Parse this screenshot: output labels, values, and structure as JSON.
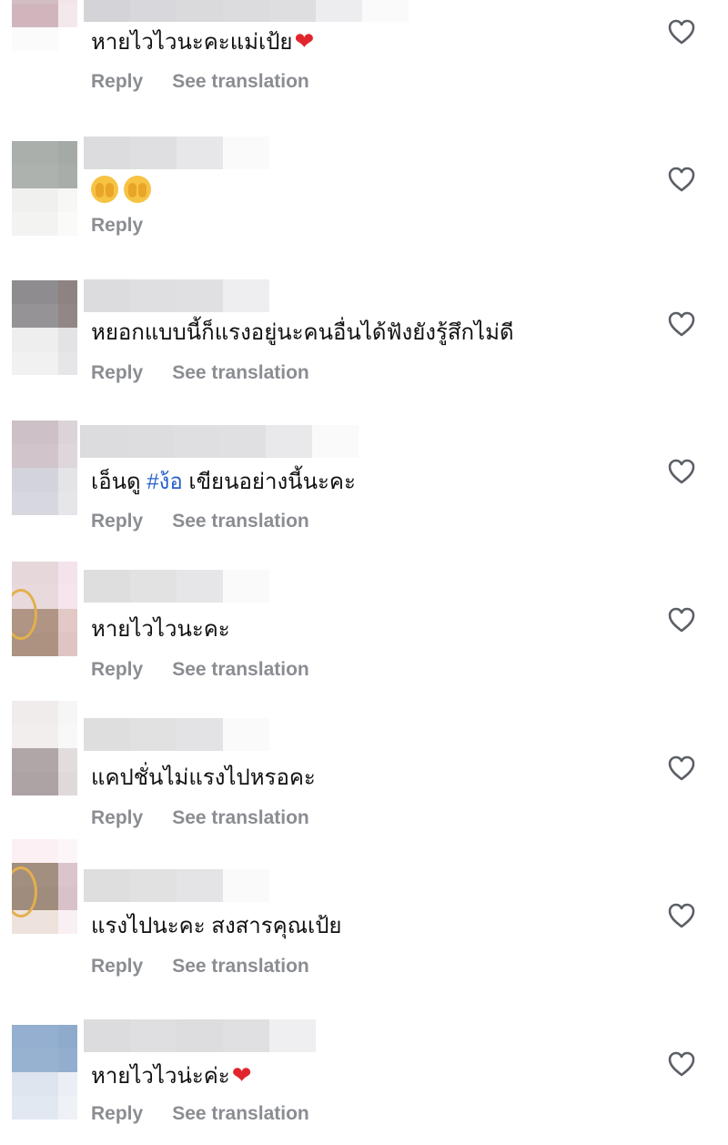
{
  "actions": {
    "reply": "Reply",
    "see_translation": "See translation"
  },
  "icons": {
    "like": "heart-outline-icon",
    "reaction": "red-heart-emoji",
    "face": "face-covering-eyes-emoji"
  },
  "colors": {
    "hashtag": "#2a62c9",
    "action_text": "#8a8d92",
    "heart_emoji": "#e0262b"
  },
  "comments": [
    {
      "text": "หายไวไวนะคะแม่เป้ย",
      "has_heart": true,
      "has_translation": true
    },
    {
      "text": "",
      "emoji_faces": 2,
      "has_translation": false
    },
    {
      "text": "หยอกแบบนี้ก็แรงอยู่นะคนอื่นได้ฟังยังรู้สึกไม่ดี",
      "has_translation": true
    },
    {
      "text_before": "เอ็นดู ",
      "hashtag": "#ง้อ",
      "text_after": " เขียนอย่างนี้นะคะ",
      "has_translation": true
    },
    {
      "text": "หายไวไวนะคะ",
      "has_translation": true
    },
    {
      "text": "แคปชั่นไม่แรงไปหรอคะ",
      "has_translation": true
    },
    {
      "text": "แรงไปนะคะ สงสารคุณเป้ย",
      "has_translation": true
    },
    {
      "text": "หายไวไวน่ะค่ะ",
      "has_heart": true,
      "has_translation": true
    }
  ]
}
